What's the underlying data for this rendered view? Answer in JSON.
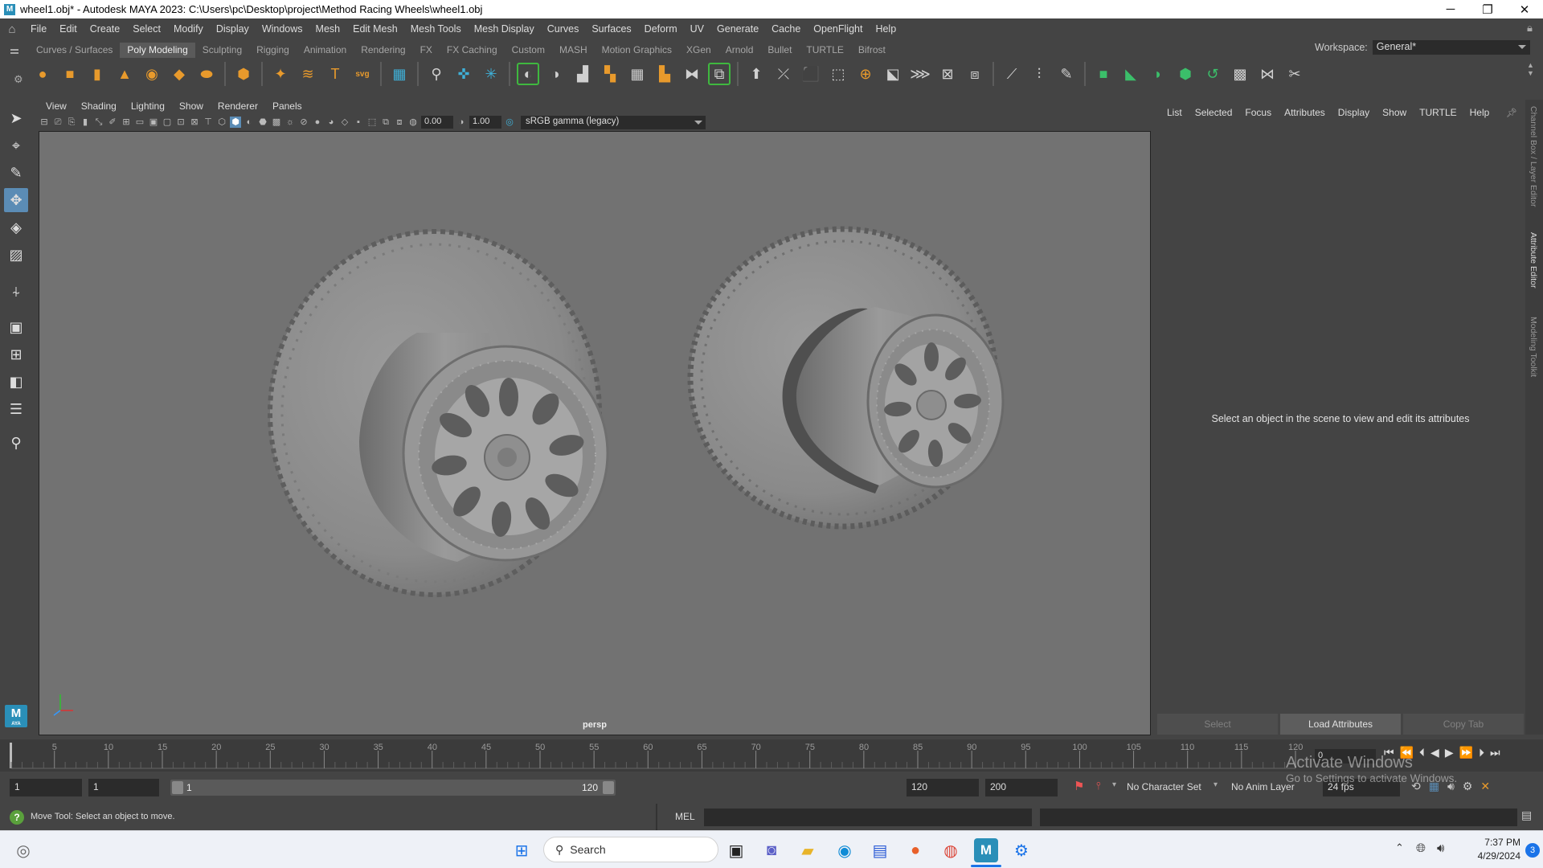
{
  "window": {
    "title": "wheel1.obj* - Autodesk MAYA 2023: C:\\Users\\pc\\Desktop\\project\\Method Racing Wheels\\wheel1.obj",
    "minimize": "─",
    "maximize": "❐",
    "close": "✕"
  },
  "menubar": {
    "items": [
      "File",
      "Edit",
      "Create",
      "Select",
      "Modify",
      "Display",
      "Windows",
      "Mesh",
      "Edit Mesh",
      "Mesh Tools",
      "Mesh Display",
      "Curves",
      "Surfaces",
      "Deform",
      "UV",
      "Generate",
      "Cache",
      "OpenFlight",
      "Help"
    ],
    "workspace_label": "Workspace:",
    "workspace_value": "General*"
  },
  "shelf": {
    "tabs": [
      "Curves / Surfaces",
      "Poly Modeling",
      "Sculpting",
      "Rigging",
      "Animation",
      "Rendering",
      "FX",
      "FX Caching",
      "Custom",
      "MASH",
      "Motion Graphics",
      "XGen",
      "Arnold",
      "Bullet",
      "TURTLE",
      "Bifrost"
    ],
    "active_tab": "Poly Modeling"
  },
  "panel": {
    "menus": [
      "View",
      "Shading",
      "Lighting",
      "Show",
      "Renderer",
      "Panels"
    ],
    "field1": "0.00",
    "field2": "1.00",
    "color_mgmt": "sRGB gamma (legacy)",
    "camera": "persp"
  },
  "attr_editor": {
    "menus": [
      "List",
      "Selected",
      "Focus",
      "Attributes",
      "Display",
      "Show",
      "TURTLE",
      "Help"
    ],
    "message": "Select an object in the scene to view and edit its attributes",
    "buttons": [
      "Select",
      "Load Attributes",
      "Copy Tab"
    ],
    "side_tabs": [
      "Channel Box / Layer Editor",
      "Attribute Editor",
      "Modeling Toolkit"
    ]
  },
  "timeline": {
    "ticks": [
      "5",
      "10",
      "15",
      "20",
      "25",
      "30",
      "35",
      "40",
      "45",
      "50",
      "55",
      "60",
      "65",
      "70",
      "75",
      "80",
      "85",
      "90",
      "95",
      "100",
      "105",
      "110",
      "115",
      "120"
    ],
    "current_frame": "0"
  },
  "range": {
    "start": "1",
    "current": "1",
    "slider_start": "1",
    "slider_end": "120",
    "end": "120",
    "anim_end": "200",
    "character_set": "No Character Set",
    "anim_layer": "No Anim Layer",
    "fps": "24 fps"
  },
  "status": {
    "help_text": "Move Tool: Select an object to move.",
    "mel_label": "MEL"
  },
  "watermark": {
    "line1": "Activate Windows",
    "line2": "Go to Settings to activate Windows."
  },
  "taskbar": {
    "search": "Search",
    "time": "7:37 PM",
    "date": "4/29/2024",
    "notifications": "3"
  },
  "colors": {
    "viewport_bg": "#727272",
    "accent_blue": "#5b8cb5",
    "shelf_orange": "#e89a2c",
    "maya_teal": "#2a8fb8"
  }
}
